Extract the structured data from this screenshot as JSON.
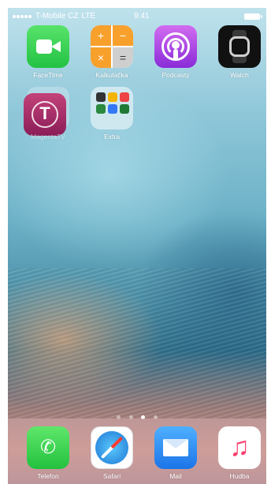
{
  "status_bar": {
    "carrier": "T-Mobile CZ",
    "network": "LTE",
    "time": "9:41",
    "signal_bars": 5
  },
  "home_apps": [
    {
      "label": "FaceTime",
      "icon": "facetime-icon"
    },
    {
      "label": "Kalkulačka",
      "icon": "calculator-icon"
    },
    {
      "label": "Podcasty",
      "icon": "podcasts-icon"
    },
    {
      "label": "Watch",
      "icon": "watch-icon"
    },
    {
      "label": "MagentaTV",
      "icon": "t-mobile-icon"
    },
    {
      "label": "Extra",
      "icon": "folder-icon"
    }
  ],
  "calculator_keys": [
    "+",
    "−",
    "×",
    "="
  ],
  "page_indicator": {
    "pages": 4,
    "current": 3
  },
  "dock": [
    {
      "label": "Telefon",
      "icon": "phone-icon"
    },
    {
      "label": "Safari",
      "icon": "safari-icon"
    },
    {
      "label": "Mail",
      "icon": "mail-icon"
    },
    {
      "label": "Hudba",
      "icon": "music-icon"
    }
  ],
  "colors": {
    "facetime": "#2ecc4f",
    "calculator_orange": "#f7a02c",
    "podcasts": "#b04be6",
    "magenta": "#a4306a",
    "phone": "#34c759",
    "mail": "#2a85f0",
    "music": "#fb3f6c"
  }
}
